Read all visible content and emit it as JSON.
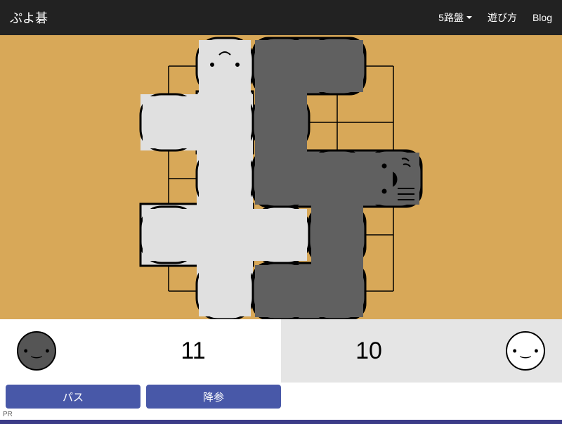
{
  "navbar": {
    "brand": "ぷよ碁",
    "boardSizeLabel": "5路盤",
    "howToPlayLabel": "遊び方",
    "blogLabel": "Blog"
  },
  "board": {
    "size": 5,
    "black_stones": [
      [
        3,
        1
      ],
      [
        4,
        1
      ],
      [
        3,
        2
      ],
      [
        3,
        3
      ],
      [
        4,
        3
      ],
      [
        5,
        3
      ],
      [
        4,
        4
      ],
      [
        3,
        5
      ],
      [
        4,
        5
      ]
    ],
    "white_stones": [
      [
        2,
        1
      ],
      [
        1,
        2
      ],
      [
        2,
        2
      ],
      [
        2,
        3
      ],
      [
        1,
        4
      ],
      [
        2,
        4
      ],
      [
        3,
        4
      ],
      [
        2,
        5
      ]
    ],
    "last_move": [
      5,
      3
    ]
  },
  "score": {
    "black": "11",
    "white": "10"
  },
  "actions": {
    "pass": "パス",
    "resign": "降参"
  },
  "footer": {
    "pr": "PR"
  }
}
